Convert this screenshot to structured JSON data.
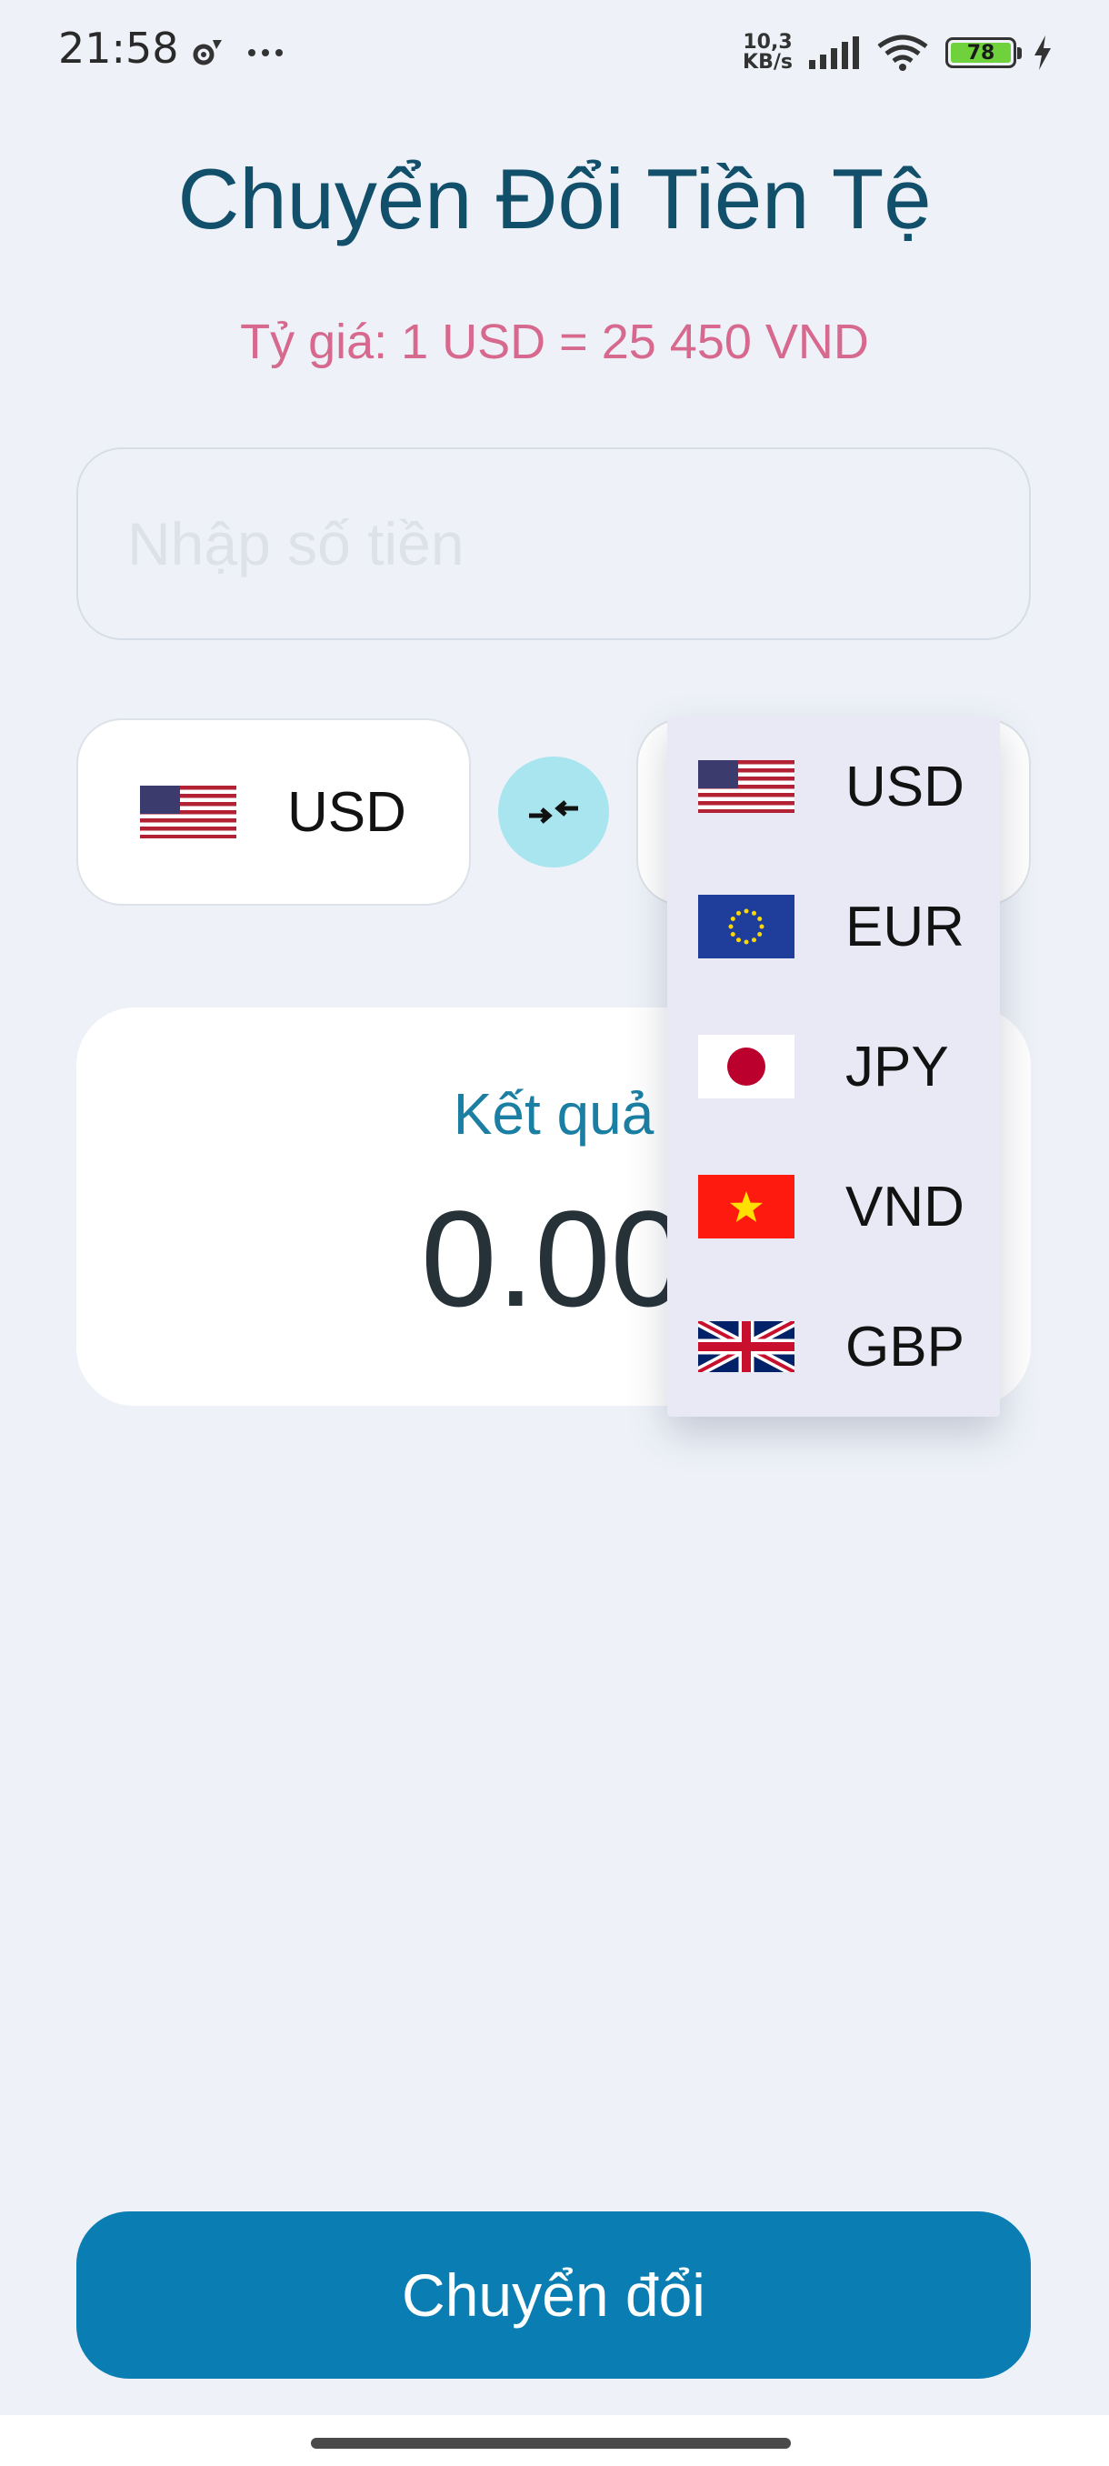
{
  "status_bar": {
    "time": "21:58",
    "network_speed_value": "10,3",
    "network_speed_unit": "KB/s",
    "battery_level": "78",
    "icons": [
      "settings-icon",
      "more-dots-icon",
      "signal-icon",
      "wifi-icon",
      "battery-icon",
      "charging-icon"
    ]
  },
  "header": {
    "title": "Chuyển Đổi Tiền Tệ",
    "rate": "Tỷ giá: 1 USD = 25 450 VND"
  },
  "amount_input": {
    "value": "",
    "placeholder": "Nhập số tiền"
  },
  "from_currency": {
    "code": "USD",
    "flag": "us-flag-icon"
  },
  "swap_button": {
    "icon": "swap-arrows-icon"
  },
  "dropdown": {
    "options": [
      {
        "code": "USD",
        "flag": "us-flag-icon"
      },
      {
        "code": "EUR",
        "flag": "eu-flag-icon"
      },
      {
        "code": "JPY",
        "flag": "jp-flag-icon"
      },
      {
        "code": "VND",
        "flag": "vn-flag-icon"
      },
      {
        "code": "GBP",
        "flag": "uk-flag-icon"
      }
    ]
  },
  "result": {
    "label": "Kết quả",
    "value": "0.00"
  },
  "convert_button": {
    "label": "Chuyển đổi"
  },
  "colors": {
    "background": "#eef2f8",
    "title": "#114f6b",
    "rate": "#d6698d",
    "accent": "#0a7db3",
    "swap_bg": "#a8e5ee",
    "dropdown_bg": "#e8e9f4"
  }
}
